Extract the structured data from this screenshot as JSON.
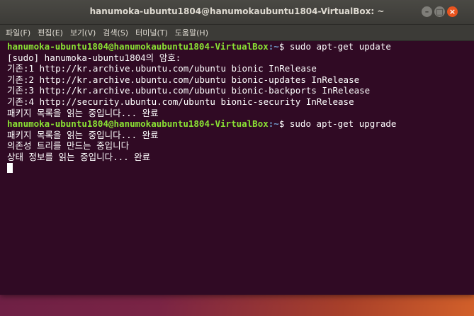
{
  "window": {
    "title": "hanumoka-ubuntu1804@hanumokaubuntu1804-VirtualBox: ~",
    "controls": {
      "minimize": "–",
      "maximize": "□",
      "close": "×"
    }
  },
  "menubar": {
    "items": [
      "파일(F)",
      "편집(E)",
      "보기(V)",
      "검색(S)",
      "터미널(T)",
      "도움말(H)"
    ]
  },
  "terminal": {
    "cmd1": {
      "user_host": "hanumoka-ubuntu1804@hanumokaubuntu1804-VirtualBox",
      "path": ":~",
      "dollar": "$",
      "command": " sudo apt-get update"
    },
    "output1": [
      "[sudo] hanumoka-ubuntu1804의 암호:",
      "기존:1 http://kr.archive.ubuntu.com/ubuntu bionic InRelease",
      "기존:2 http://kr.archive.ubuntu.com/ubuntu bionic-updates InRelease",
      "기존:3 http://kr.archive.ubuntu.com/ubuntu bionic-backports InRelease",
      "기존:4 http://security.ubuntu.com/ubuntu bionic-security InRelease",
      "패키지 목록을 읽는 중입니다... 완료"
    ],
    "cmd2": {
      "user_host": "hanumoka-ubuntu1804@hanumokaubuntu1804-VirtualBox",
      "path": ":~",
      "dollar": "$",
      "command": " sudo apt-get upgrade"
    },
    "output2": [
      "패키지 목록을 읽는 중입니다... 완료",
      "의존성 트리를 만드는 중입니다",
      "상태 정보를 읽는 중입니다... 완료"
    ]
  },
  "colors": {
    "terminal_bg": "#300a24",
    "prompt_user": "#8ae234",
    "prompt_path": "#729fcf",
    "close_button": "#e9541f"
  }
}
